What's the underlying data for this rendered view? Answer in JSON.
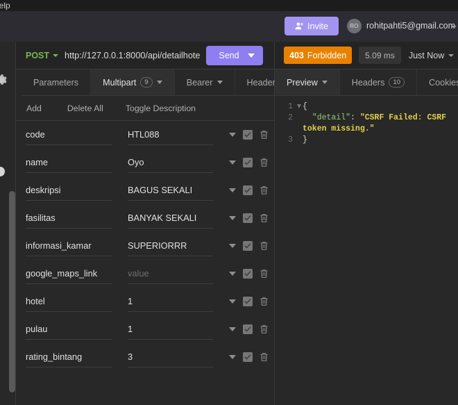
{
  "menubar": {
    "help": "Help"
  },
  "header": {
    "invite_label": "Invite",
    "avatar_initials": "RO",
    "account_email": "rohitpahti5@gmail.com"
  },
  "request": {
    "method": "POST",
    "url": "http://127.0.0.1:8000/api/detailhote",
    "send_label": "Send"
  },
  "response_status": {
    "code": "403",
    "text": "Forbidden",
    "time": "5.09 ms",
    "when": "Just Now"
  },
  "request_tabs": [
    {
      "label": "Parameters",
      "count": "",
      "caret": false,
      "active": false
    },
    {
      "label": "Multipart",
      "count": "9",
      "caret": true,
      "active": true
    },
    {
      "label": "Bearer",
      "count": "",
      "caret": true,
      "active": false
    },
    {
      "label": "Header",
      "count": "",
      "caret": false,
      "active": false
    }
  ],
  "response_tabs": [
    {
      "label": "Preview",
      "count": "",
      "caret": true,
      "active": true
    },
    {
      "label": "Headers",
      "count": "10",
      "caret": false,
      "active": false
    },
    {
      "label": "Cookies",
      "count": "",
      "caret": false,
      "active": false
    }
  ],
  "toolbar": {
    "add": "Add",
    "delete_all": "Delete All",
    "toggle_description": "Toggle Description"
  },
  "value_placeholder": "value",
  "params": [
    {
      "name": "code",
      "value": "HTL088",
      "is_placeholder": false,
      "enabled": true
    },
    {
      "name": "name",
      "value": "Oyo",
      "is_placeholder": false,
      "enabled": true
    },
    {
      "name": "deskripsi",
      "value": "BAGUS SEKALI",
      "is_placeholder": false,
      "enabled": true
    },
    {
      "name": "fasilitas",
      "value": "BANYAK SEKALI",
      "is_placeholder": false,
      "enabled": true
    },
    {
      "name": "informasi_kamar",
      "value": "SUPERIORRR",
      "is_placeholder": false,
      "enabled": true
    },
    {
      "name": "google_maps_link",
      "value": "value",
      "is_placeholder": true,
      "enabled": true
    },
    {
      "name": "hotel",
      "value": "1",
      "is_placeholder": false,
      "enabled": true
    },
    {
      "name": "pulau",
      "value": "1",
      "is_placeholder": false,
      "enabled": true
    },
    {
      "name": "rating_bintang",
      "value": "3",
      "is_placeholder": false,
      "enabled": true
    }
  ],
  "response_body": {
    "line1_num": "1",
    "line1_text": "{",
    "line2_num": "2",
    "line2_key": "\"detail\"",
    "line2_colon": ": ",
    "line2_value": "\"CSRF Failed: CSRF token missing.\"",
    "line3_num": "3",
    "line3_text": "}"
  },
  "colors": {
    "accent_purple": "#8e7ef0",
    "invite_purple": "#a394f3",
    "status_orange": "#e98100",
    "method_green": "#7ab84f",
    "json_string": "#e1d24a",
    "json_key": "#95c878",
    "background": "#282828"
  }
}
